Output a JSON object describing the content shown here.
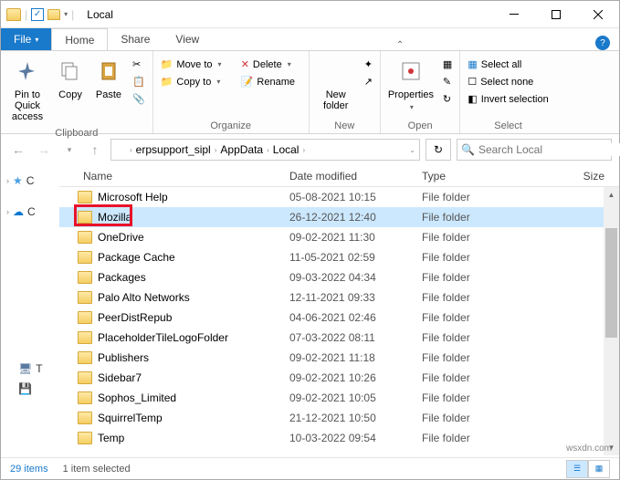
{
  "window": {
    "title": "Local"
  },
  "ribbon": {
    "file": "File",
    "tabs": [
      "Home",
      "Share",
      "View"
    ],
    "clipboard": {
      "pin": "Pin to Quick access",
      "copy": "Copy",
      "paste": "Paste",
      "label": "Clipboard"
    },
    "organize": {
      "moveto": "Move to",
      "copyto": "Copy to",
      "delete": "Delete",
      "rename": "Rename",
      "label": "Organize"
    },
    "new": {
      "newfolder": "New folder",
      "label": "New"
    },
    "open": {
      "properties": "Properties",
      "label": "Open"
    },
    "select": {
      "all": "Select all",
      "none": "Select none",
      "invert": "Invert selection",
      "label": "Select"
    }
  },
  "breadcrumbs": [
    "erpsupport_sipl",
    "AppData",
    "Local"
  ],
  "search": {
    "placeholder": "Search Local"
  },
  "columns": {
    "name": "Name",
    "date": "Date modified",
    "type": "Type",
    "size": "Size"
  },
  "navpane": [
    {
      "label": "C",
      "icon": "star"
    },
    {
      "label": "C",
      "icon": "onedrive"
    },
    {
      "label": "T",
      "icon": "pc"
    },
    {
      "label": "",
      "icon": "drive"
    }
  ],
  "items": [
    {
      "name": "Microsoft Help",
      "date": "05-08-2021 10:15",
      "type": "File folder",
      "selected": false
    },
    {
      "name": "Mozilla",
      "date": "26-12-2021 12:40",
      "type": "File folder",
      "selected": true
    },
    {
      "name": "OneDrive",
      "date": "09-02-2021 11:30",
      "type": "File folder",
      "selected": false
    },
    {
      "name": "Package Cache",
      "date": "11-05-2021 02:59",
      "type": "File folder",
      "selected": false
    },
    {
      "name": "Packages",
      "date": "09-03-2022 04:34",
      "type": "File folder",
      "selected": false
    },
    {
      "name": "Palo Alto Networks",
      "date": "12-11-2021 09:33",
      "type": "File folder",
      "selected": false
    },
    {
      "name": "PeerDistRepub",
      "date": "04-06-2021 02:46",
      "type": "File folder",
      "selected": false
    },
    {
      "name": "PlaceholderTileLogoFolder",
      "date": "07-03-2022 08:11",
      "type": "File folder",
      "selected": false
    },
    {
      "name": "Publishers",
      "date": "09-02-2021 11:18",
      "type": "File folder",
      "selected": false
    },
    {
      "name": "Sidebar7",
      "date": "09-02-2021 10:26",
      "type": "File folder",
      "selected": false
    },
    {
      "name": "Sophos_Limited",
      "date": "09-02-2021 10:05",
      "type": "File folder",
      "selected": false
    },
    {
      "name": "SquirrelTemp",
      "date": "21-12-2021 10:50",
      "type": "File folder",
      "selected": false
    },
    {
      "name": "Temp",
      "date": "10-03-2022 09:54",
      "type": "File folder",
      "selected": false
    }
  ],
  "status": {
    "count": "29 items",
    "selected": "1 item selected"
  },
  "watermark": "wsxdn.com"
}
